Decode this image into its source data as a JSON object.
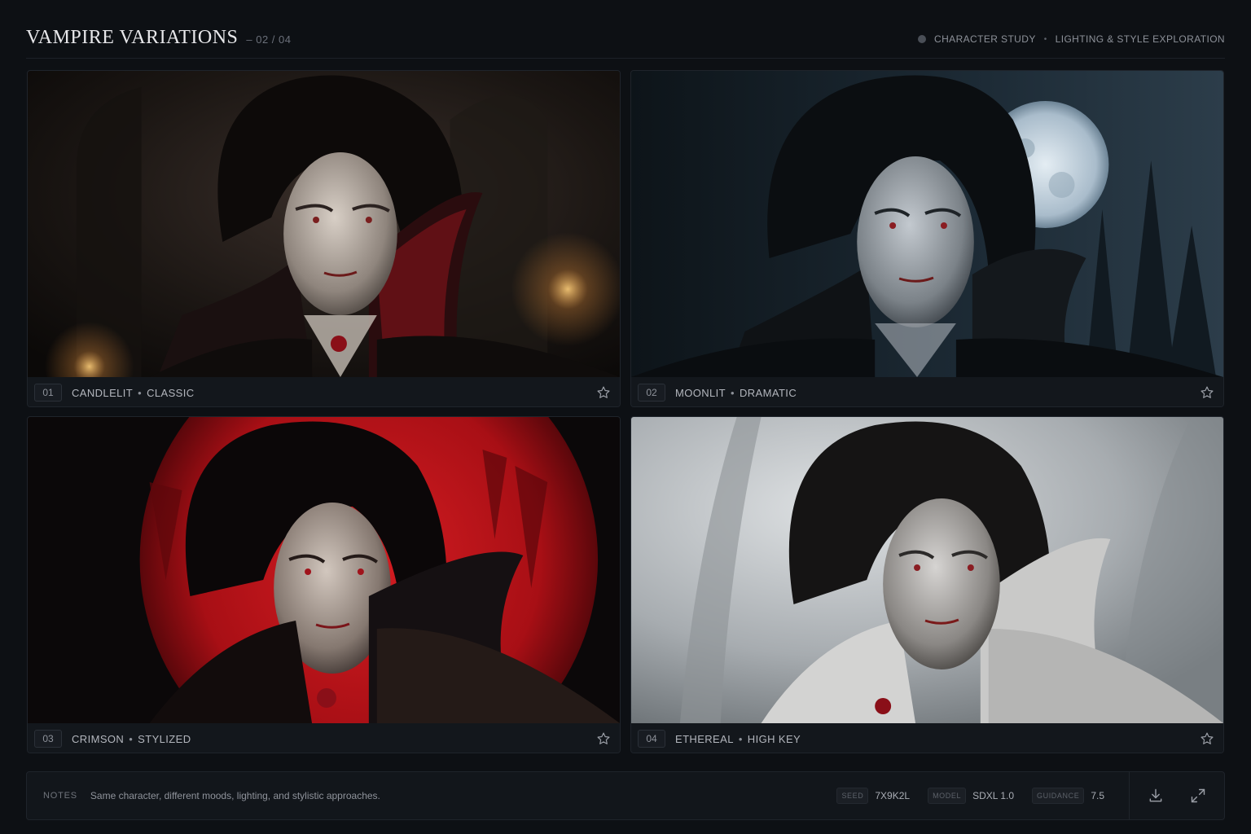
{
  "header": {
    "title": "VAMPIRE VARIATIONS",
    "counter": "– 02 / 04",
    "tag_primary": "CHARACTER STUDY",
    "tag_secondary": "LIGHTING & STYLE EXPLORATION"
  },
  "cards": [
    {
      "number": "01",
      "mood": "CANDLELIT",
      "style": "CLASSIC",
      "favorite_icon": "star-outline"
    },
    {
      "number": "02",
      "mood": "MOONLIT",
      "style": "DRAMATIC",
      "favorite_icon": "star-outline"
    },
    {
      "number": "03",
      "mood": "CRIMSON",
      "style": "STYLIZED",
      "favorite_icon": "star-outline"
    },
    {
      "number": "04",
      "mood": "ETHEREAL",
      "style": "HIGH KEY",
      "favorite_icon": "star-outline"
    }
  ],
  "caption_separator": "•",
  "meta_separator": "•",
  "footer": {
    "notes_label": "NOTES",
    "notes_text": "Same character, different moods, lighting, and stylistic approaches.",
    "params": [
      {
        "key": "SEED",
        "value": "7X9K2L"
      },
      {
        "key": "MODEL",
        "value": "SDXL 1.0"
      },
      {
        "key": "GUIDANCE",
        "value": "7.5"
      }
    ],
    "actions": [
      "download-icon",
      "expand-icon"
    ]
  },
  "colors": {
    "background": "#0d1014",
    "card": "#14181e",
    "crimson": "#b5141a",
    "moon": "#cfdbe4"
  }
}
